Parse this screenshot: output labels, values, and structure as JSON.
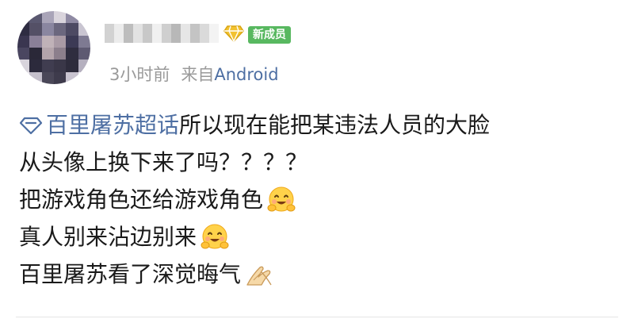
{
  "post": {
    "member_badge": "新成员",
    "time": "3小时前",
    "from_label": "来自",
    "source": "Android",
    "topic": "百里屠苏超话",
    "lines": [
      "所以现在能把某违法人员的大脸",
      "从头像上换下来了吗？？？？",
      "把游戏角色还给游戏角色",
      "真人别来沾边别来",
      "百里屠苏看了深觉晦气"
    ],
    "emojis": [
      "hugging-face-emoji",
      "hugging-face-emoji",
      "pray-hands-emoji"
    ]
  },
  "colors": {
    "link": "#4e6fa3",
    "member_badge": "#58b860",
    "meta": "#9a9a9a"
  }
}
